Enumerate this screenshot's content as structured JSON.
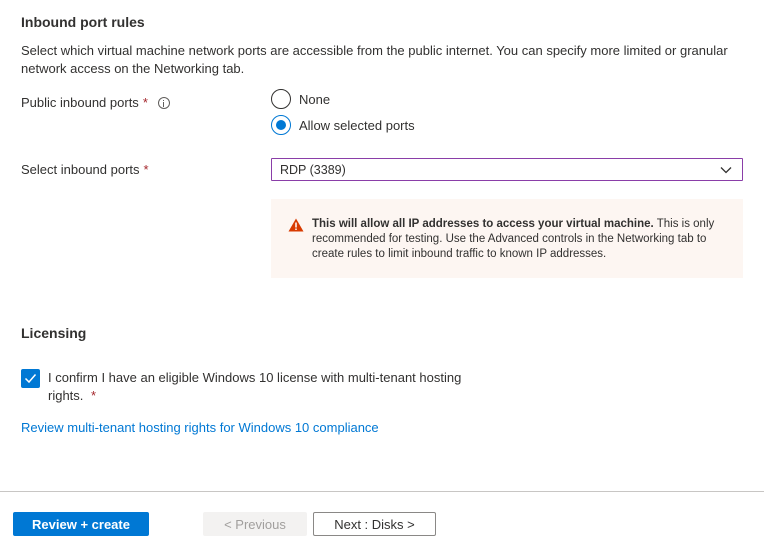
{
  "inbound": {
    "title": "Inbound port rules",
    "description": "Select which virtual machine network ports are accessible from the public internet. You can specify more limited or granular network access on the Networking tab.",
    "public_ports_label": "Public inbound ports",
    "required_mark": "*",
    "radio_options": [
      {
        "label": "None",
        "checked": false
      },
      {
        "label": "Allow selected ports",
        "checked": true
      }
    ],
    "select_ports_label": "Select inbound ports",
    "select_value": "RDP (3389)",
    "warning_bold": "This will allow all IP addresses to access your virtual machine.",
    "warning_text": "This is only recommended for testing.  Use the Advanced controls in the Networking tab to create rules to limit inbound traffic to known IP addresses."
  },
  "licensing": {
    "title": "Licensing",
    "checkbox_checked": true,
    "checkbox_label": "I confirm I have an eligible Windows 10 license with multi-tenant hosting rights.",
    "required_mark": "*",
    "link_text": "Review multi-tenant hosting rights for Windows 10 compliance"
  },
  "footer": {
    "review_create": "Review + create",
    "previous": "< Previous",
    "next": "Next : Disks >"
  },
  "colors": {
    "accent": "#0078d4",
    "warning_bg": "#fdf6f2",
    "warning_icon": "#d83b01",
    "required": "#a4262c",
    "select_border": "#8a3ea8"
  }
}
